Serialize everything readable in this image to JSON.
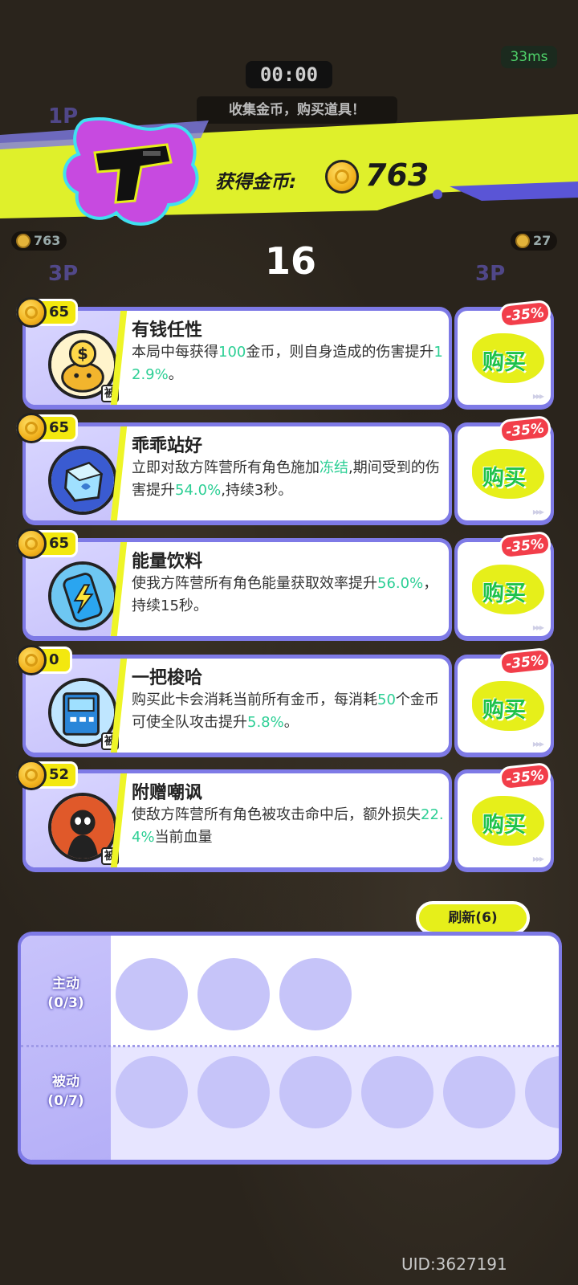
{
  "hud": {
    "timer": "00:00",
    "ping": "33ms",
    "hint": "收集金币，购买道具！",
    "left_coins": "763",
    "right_coins": "27",
    "left_tag_1p": "1P",
    "left_tag_3p": "3P",
    "right_tag_3p": "3P"
  },
  "banner": {
    "title": "获得金币:",
    "amount": "763",
    "icon": "pistol-icon"
  },
  "countdown": "16",
  "cards": [
    {
      "price": "65",
      "discount": "-35%",
      "name": "有钱任性",
      "icon": "piggy-bank-icon",
      "passive": true,
      "desc_parts": [
        "本局中每获得",
        "100",
        "金币，则自身造成的伤害提升",
        "12.9%",
        "。"
      ],
      "buy": "购买"
    },
    {
      "price": "65",
      "discount": "-35%",
      "name": "乖乖站好",
      "icon": "ice-cube-icon",
      "passive": false,
      "desc_parts": [
        "立即对敌方阵营所有角色施加",
        "冻结",
        ",期间受到的伤害提升",
        "54.0%",
        ",持续3秒。"
      ],
      "buy": "购买"
    },
    {
      "price": "65",
      "discount": "-35%",
      "name": "能量饮料",
      "icon": "energy-drink-icon",
      "passive": false,
      "desc_parts": [
        "使我方阵营所有角色能量获取效率提升",
        "56.0%",
        "，持续15秒。"
      ],
      "buy": "购买"
    },
    {
      "price": "0",
      "discount": "-35%",
      "name": "一把梭哈",
      "icon": "atm-icon",
      "passive": true,
      "desc_parts": [
        "购买此卡会消耗当前所有金币，每消耗",
        "50",
        "个金币可使全队攻击提升",
        "5.8%",
        "。"
      ],
      "buy": "购买"
    },
    {
      "price": "52",
      "discount": "-35%",
      "name": "附赠嘲讽",
      "icon": "taunt-silhouette-icon",
      "passive": true,
      "desc_parts": [
        "使敌方阵营所有角色被攻击命中后，额外损失",
        "22.4%",
        "当前血量"
      ],
      "buy": "购买"
    }
  ],
  "passive_badge": "被",
  "refresh": "刷新(6)",
  "slots": {
    "active_label": "主动",
    "active_count": "(0/3)",
    "passive_label": "被动",
    "passive_count": "(0/7)"
  },
  "uid": "UID:3627191",
  "colors": {
    "accent_purple": "#7e7ae6",
    "accent_yellow": "#e6ef1a",
    "buy_green": "#1ec24a",
    "highlight_green": "#2dcf95",
    "discount_red": "#f23e4a"
  }
}
